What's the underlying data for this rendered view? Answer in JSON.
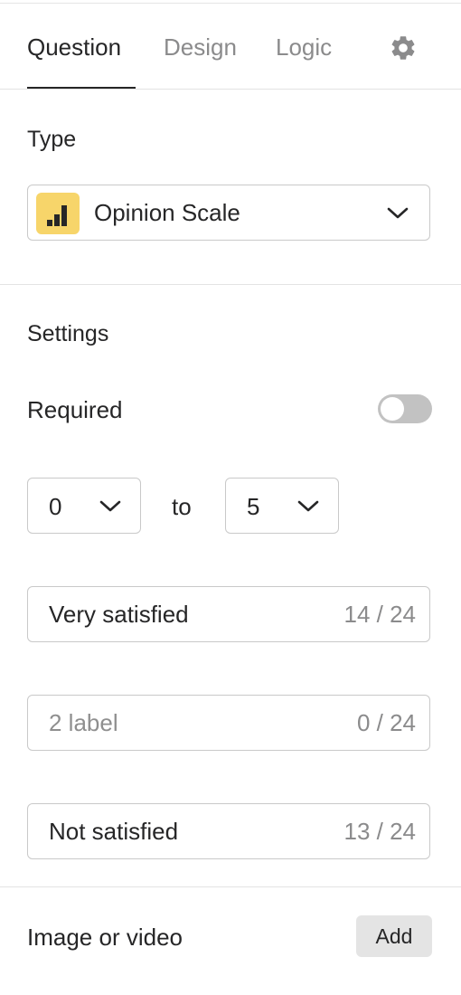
{
  "tabs": [
    {
      "label": "Question",
      "active": true
    },
    {
      "label": "Design",
      "active": false
    },
    {
      "label": "Logic",
      "active": false
    }
  ],
  "settings_icon": "gear-icon",
  "type_section": {
    "title": "Type",
    "selected": "Opinion Scale",
    "icon": "bar-chart-icon",
    "icon_bg": "#f7d56a"
  },
  "settings": {
    "title": "Settings",
    "required_label": "Required",
    "required_on": false,
    "scale_from": "0",
    "to_label": "to",
    "scale_to": "5"
  },
  "labels": [
    {
      "value": "Very satisfied",
      "placeholder": "",
      "count": "14 / 24"
    },
    {
      "value": "",
      "placeholder": "2 label",
      "count": "0 / 24"
    },
    {
      "value": "Not satisfied",
      "placeholder": "",
      "count": "13 / 24"
    }
  ],
  "media": {
    "title": "Image or video",
    "add_label": "Add"
  },
  "colors": {
    "text": "#262627",
    "muted": "#8b8b8c",
    "border": "#c9c9c9",
    "toggle_off": "#c2c2c2",
    "button_bg": "#e4e4e4"
  }
}
